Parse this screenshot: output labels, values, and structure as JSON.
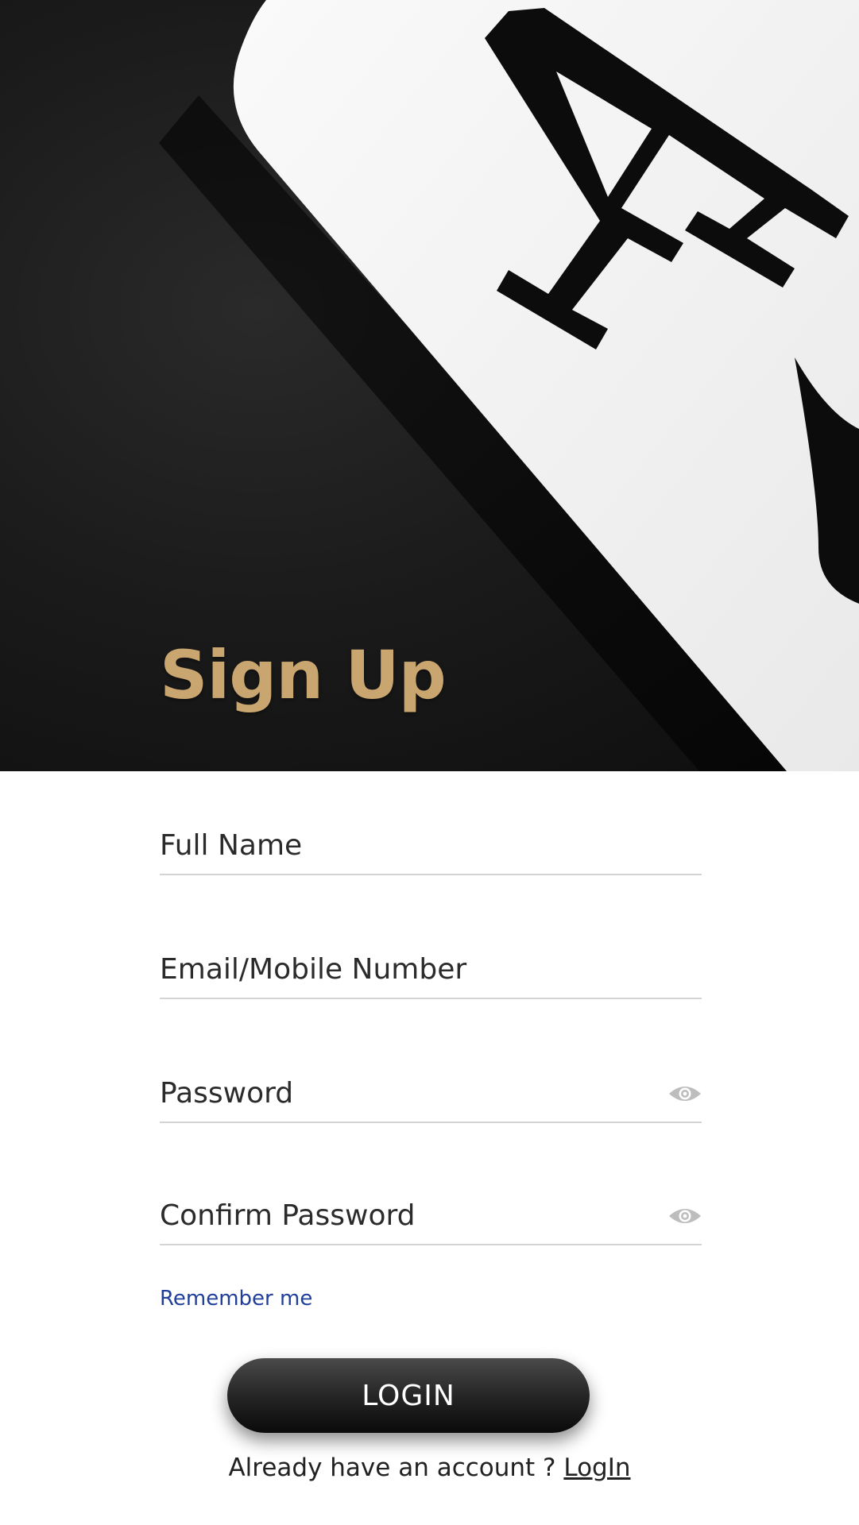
{
  "header": {
    "title": "Sign Up",
    "title_color": "#c9a56f"
  },
  "form": {
    "full_name": {
      "placeholder": "Full Name",
      "value": ""
    },
    "email": {
      "placeholder": "Email/Mobile Number",
      "value": ""
    },
    "password": {
      "placeholder": "Password",
      "value": "",
      "icon": "eye-icon"
    },
    "confirm_password": {
      "placeholder": "Confirm Password",
      "value": "",
      "icon": "eye-icon"
    },
    "remember_label": "Remember me",
    "remember_color": "#1f3f9a"
  },
  "actions": {
    "login_label": "LOGIN"
  },
  "footer": {
    "prompt": "Already have an account ? ",
    "link_label": "LogIn"
  },
  "colors": {
    "background": "#ffffff",
    "hero_dark": "#1b1b1b",
    "card_white": "#f4f4f4",
    "button_dark": "#1a1a1a",
    "divider": "#d4d4d4"
  }
}
